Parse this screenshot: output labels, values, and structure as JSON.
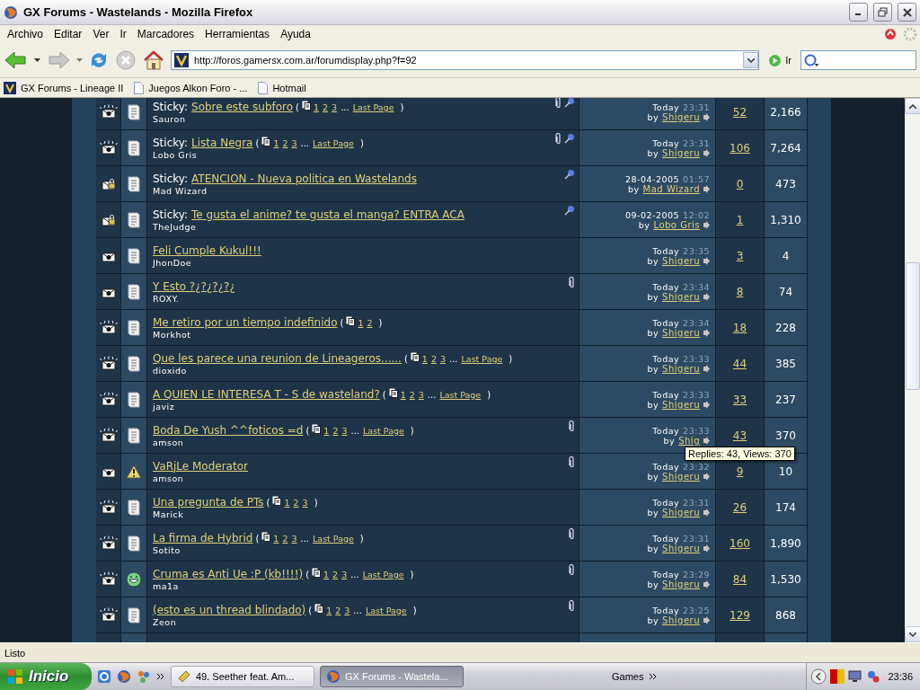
{
  "window": {
    "title": "GX Forums - Wastelands - Mozilla Firefox"
  },
  "menu": [
    "Archivo",
    "Editar",
    "Ver",
    "Ir",
    "Marcadores",
    "Herramientas",
    "Ayuda"
  ],
  "address": {
    "value": "http://foros.gamersx.com.ar/forumdisplay.php?f=92",
    "go_label": "Ir"
  },
  "bookmarks": [
    {
      "label": "GX Forums - Lineage II",
      "kind": "site"
    },
    {
      "label": "Juegos Alkon Foro - ...",
      "kind": "page"
    },
    {
      "label": "Hotmail",
      "kind": "page"
    }
  ],
  "threads": [
    {
      "kind": "hot",
      "post_icon": {
        "kind": "document"
      },
      "prefix": "Sticky:",
      "title": "Sobre este subforo",
      "open": "(",
      "pages": [
        "1",
        "2",
        "3"
      ],
      "ellipsis": "...",
      "last_page": "Last Page",
      "close": ")",
      "author": "Sauron",
      "attachment": true,
      "sticky": true,
      "date": "Today",
      "time": "23:31",
      "by": "by",
      "last_poster": "Shigeru",
      "replies": "52",
      "views": "2,166"
    },
    {
      "kind": "hot",
      "post_icon": {
        "kind": "document"
      },
      "prefix": "Sticky:",
      "title": "Lista Negra",
      "open": "(",
      "pages": [
        "1",
        "2",
        "3"
      ],
      "ellipsis": "...",
      "last_page": "Last Page",
      "close": ")",
      "author": "Lobo Gris",
      "attachment": true,
      "sticky": true,
      "date": "Today",
      "time": "23:31",
      "by": "by",
      "last_poster": "Shigeru",
      "replies": "106",
      "views": "7,264"
    },
    {
      "kind": "locked",
      "post_icon": {
        "kind": "document"
      },
      "prefix": "Sticky:",
      "title": "ATENCION - Nueva politica en Wastelands",
      "author": "Mad Wizard",
      "attachment": false,
      "sticky": true,
      "date": "28-04-2005",
      "time": "01:57",
      "by": "by",
      "last_poster": "Mad Wizard",
      "replies": "0",
      "views": "473"
    },
    {
      "kind": "locked",
      "post_icon": {
        "kind": "document"
      },
      "prefix": "Sticky:",
      "title": "Te gusta el anime? te gusta el manga? ENTRA ACA",
      "author": "TheJudge",
      "attachment": false,
      "sticky": true,
      "date": "09-02-2005",
      "time": "12:02",
      "by": "by",
      "last_poster": "Lobo Gris",
      "replies": "1",
      "views": "1,310"
    },
    {
      "kind": "plain",
      "post_icon": {
        "kind": "document"
      },
      "title": "Feli Cumple Kukul!!!",
      "author": "JhonDoe",
      "attachment": false,
      "sticky": false,
      "date": "Today",
      "time": "23:35",
      "by": "by",
      "last_poster": "Shigeru",
      "replies": "3",
      "views": "4"
    },
    {
      "kind": "plain",
      "post_icon": {
        "kind": "document"
      },
      "title": "Y Esto ?¿?¿?¿?¿",
      "author": "ROXY.",
      "attachment": true,
      "sticky": false,
      "date": "Today",
      "time": "23:34",
      "by": "by",
      "last_poster": "Shigeru",
      "replies": "8",
      "views": "74"
    },
    {
      "kind": "hot",
      "post_icon": {
        "kind": "document"
      },
      "title": "Me retiro por un tiempo indefinido",
      "open": "(",
      "pages": [
        "1",
        "2"
      ],
      "close": ")",
      "author": "Morkhot",
      "attachment": false,
      "sticky": false,
      "date": "Today",
      "time": "23:34",
      "by": "by",
      "last_poster": "Shigeru",
      "replies": "18",
      "views": "228"
    },
    {
      "kind": "hot",
      "post_icon": {
        "kind": "document"
      },
      "title": "Que les parece una reunion de Lineageros......",
      "open": "(",
      "pages": [
        "1",
        "2",
        "3"
      ],
      "ellipsis": "...",
      "last_page": "Last Page",
      "close": ")",
      "author": "dioxido",
      "attachment": false,
      "sticky": false,
      "date": "Today",
      "time": "23:33",
      "by": "by",
      "last_poster": "Shigeru",
      "replies": "44",
      "views": "385"
    },
    {
      "kind": "hot",
      "post_icon": {
        "kind": "document"
      },
      "title": "A QUIEN LE INTERESA T - S de wasteland?",
      "open": "(",
      "pages": [
        "1",
        "2",
        "3"
      ],
      "ellipsis": "...",
      "last_page": "Last Page",
      "close": ")",
      "author": "javiz",
      "attachment": false,
      "sticky": false,
      "date": "Today",
      "time": "23:33",
      "by": "by",
      "last_poster": "Shigeru",
      "replies": "33",
      "views": "237"
    },
    {
      "kind": "hot",
      "post_icon": {
        "kind": "document"
      },
      "title": "Boda De Yush ^^foticos =d",
      "open": "(",
      "pages": [
        "1",
        "2",
        "3"
      ],
      "ellipsis": "...",
      "last_page": "Last Page",
      "close": ")",
      "author": "amson",
      "attachment": true,
      "sticky": false,
      "date": "Today",
      "time": "23:33",
      "by": "by",
      "last_poster": "Shig",
      "replies": "43",
      "views": "370"
    },
    {
      "kind": "plain",
      "post_icon": {
        "kind": "warning"
      },
      "title": "VaRjLe Moderator",
      "author": "amson",
      "attachment": true,
      "sticky": false,
      "date": "Today",
      "time": "23:32",
      "by": "by",
      "last_poster": "Shigeru",
      "replies": "9",
      "views": "10"
    },
    {
      "kind": "hot",
      "post_icon": {
        "kind": "document"
      },
      "title": "Una pregunta de PTs",
      "open": "(",
      "pages": [
        "1",
        "2",
        "3"
      ],
      "close": ")",
      "author": "Marick",
      "attachment": false,
      "sticky": false,
      "date": "Today",
      "time": "23:31",
      "by": "by",
      "last_poster": "Shigeru",
      "replies": "26",
      "views": "174"
    },
    {
      "kind": "hot",
      "post_icon": {
        "kind": "document"
      },
      "title": "La firma de Hybrid",
      "open": "(",
      "pages": [
        "1",
        "2",
        "3"
      ],
      "ellipsis": "...",
      "last_page": "Last Page",
      "close": ")",
      "author": "Sotito",
      "attachment": true,
      "sticky": false,
      "date": "Today",
      "time": "23:31",
      "by": "by",
      "last_poster": "Shigeru",
      "replies": "160",
      "views": "1,890"
    },
    {
      "kind": "hot",
      "post_icon": {
        "kind": "grin"
      },
      "title": "Cruma es Anti Ue :P (kb!!!!)",
      "open": "(",
      "pages": [
        "1",
        "2",
        "3"
      ],
      "ellipsis": "...",
      "last_page": "Last Page",
      "close": ")",
      "author": "ma1a",
      "attachment": true,
      "sticky": false,
      "date": "Today",
      "time": "23:29",
      "by": "by",
      "last_poster": "Shigeru",
      "replies": "84",
      "views": "1,530"
    },
    {
      "kind": "hot",
      "post_icon": {
        "kind": "document"
      },
      "title": "(esto es un thread blindado)",
      "open": "(",
      "pages": [
        "1",
        "2",
        "3"
      ],
      "ellipsis": "...",
      "last_page": "Last Page",
      "close": ")",
      "author": "Zeon",
      "attachment": true,
      "sticky": false,
      "date": "Today",
      "time": "23:25",
      "by": "by",
      "last_poster": "Shigeru",
      "replies": "129",
      "views": "868"
    }
  ],
  "tooltip": "Replies: 43, Views: 370",
  "status_bar": "Listo",
  "taskbar": {
    "start": "Inicio",
    "tasks": [
      {
        "label": "49. Seether feat. Am...",
        "kind": "media",
        "selected": false
      },
      {
        "label": "GX Forums - Wastela...",
        "kind": "browser",
        "selected": true
      }
    ],
    "toolbar_label": "Games",
    "clock": "23:36"
  }
}
